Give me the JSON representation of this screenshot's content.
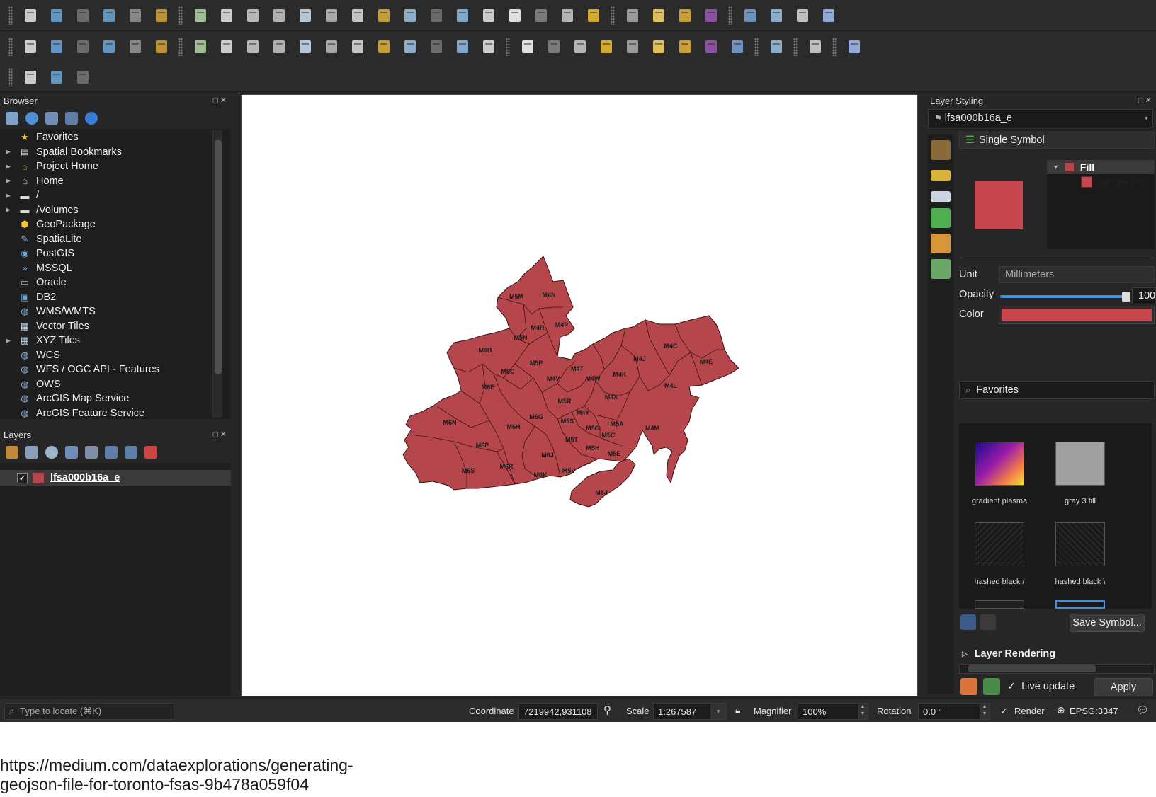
{
  "toolbar": {
    "row1_icons": [
      "new-project-icon",
      "open-project-icon",
      "save-project-icon",
      "new-print-layout-icon",
      "layout-manager-icon",
      "style-manager-icon",
      "pan-map-icon",
      "pan-to-selection-icon",
      "zoom-in-icon",
      "zoom-out-icon",
      "zoom-full-icon",
      "zoom-to-selection-icon",
      "zoom-to-layer-icon",
      "zoom-native-icon",
      "zoom-last-icon",
      "zoom-next-icon",
      "new-map-view-icon",
      "new-3d-view-icon",
      "new-bookmark-icon",
      "show-bookmarks-icon",
      "temporal-controller-icon",
      "refresh-icon",
      "identify-features-icon",
      "attribute-table-icon",
      "field-calculator-icon",
      "statistics-icon",
      "measure-icon",
      "map-tips-icon",
      "settings-gear-icon",
      "text-annotation-icon"
    ],
    "row2_icons": [
      "data-source-manager-icon",
      "new-geopackage-layer-icon",
      "new-temporary-layer-icon",
      "digitize-icon",
      "create-layer-icon",
      "virtual-layer-icon",
      "current-edits-icon",
      "toggle-editing-icon",
      "save-edits-icon",
      "add-feature-icon",
      "vertex-tool-icon",
      "modify-attributes-icon",
      "delete-selected-icon",
      "cut-features-icon",
      "copy-features-icon",
      "paste-features-icon",
      "undo-icon",
      "redo-icon",
      "layer-labeling-icon",
      "layer-diagram-icon",
      "pin-labels-icon",
      "show-hide-labels-icon",
      "label-highlight-icon",
      "move-label-icon",
      "rotate-label-icon",
      "change-label-icon",
      "label-properties-icon",
      "plugins-globe-icon",
      "python-console-icon",
      "help-icon"
    ],
    "row3_icons": [
      "select-features-icon",
      "select-by-value-icon",
      "deselect-features-icon"
    ]
  },
  "browser": {
    "title": "Browser",
    "items": [
      {
        "label": "Favorites",
        "icon": "star-icon",
        "expandable": false
      },
      {
        "label": "Spatial Bookmarks",
        "icon": "bookmark-icon",
        "expandable": true
      },
      {
        "label": "Project Home",
        "icon": "project-home-icon",
        "expandable": true
      },
      {
        "label": "Home",
        "icon": "home-icon",
        "expandable": true
      },
      {
        "label": "/",
        "icon": "folder-icon",
        "expandable": true
      },
      {
        "label": "/Volumes",
        "icon": "folder-icon",
        "expandable": true
      },
      {
        "label": "GeoPackage",
        "icon": "geopackage-icon",
        "expandable": false
      },
      {
        "label": "SpatiaLite",
        "icon": "spatialite-icon",
        "expandable": false
      },
      {
        "label": "PostGIS",
        "icon": "postgis-icon",
        "expandable": false
      },
      {
        "label": "MSSQL",
        "icon": "mssql-icon",
        "expandable": false
      },
      {
        "label": "Oracle",
        "icon": "oracle-icon",
        "expandable": false
      },
      {
        "label": "DB2",
        "icon": "db2-icon",
        "expandable": false
      },
      {
        "label": "WMS/WMTS",
        "icon": "wms-globe-icon",
        "expandable": false
      },
      {
        "label": "Vector Tiles",
        "icon": "vector-tiles-icon",
        "expandable": false
      },
      {
        "label": "XYZ Tiles",
        "icon": "xyz-tiles-icon",
        "expandable": true
      },
      {
        "label": "WCS",
        "icon": "wcs-globe-icon",
        "expandable": false
      },
      {
        "label": "WFS / OGC API - Features",
        "icon": "wfs-globe-icon",
        "expandable": false
      },
      {
        "label": "OWS",
        "icon": "ows-globe-icon",
        "expandable": false
      },
      {
        "label": "ArcGIS Map Service",
        "icon": "arcgis-globe-icon",
        "expandable": false
      },
      {
        "label": "ArcGIS Feature Service",
        "icon": "arcgis-globe-icon",
        "expandable": false
      }
    ]
  },
  "layers": {
    "title": "Layers",
    "items": [
      {
        "name": "lfsa000b16a_e",
        "checked": true,
        "color": "#b5474c"
      }
    ]
  },
  "map": {
    "fill_color": "#b5474c",
    "stroke_color": "#3b1214",
    "labels": [
      "M5M",
      "M4N",
      "M4R",
      "M4P",
      "M5N",
      "M6B",
      "M5P",
      "M6C",
      "M4T",
      "M4V",
      "M4W",
      "M4K",
      "M4J",
      "M4C",
      "M4E",
      "M6E",
      "M4L",
      "M5R",
      "M4X",
      "M6N",
      "M6G",
      "M4Y",
      "M5S",
      "M5A",
      "M6H",
      "M5G",
      "M5C",
      "M4M",
      "M5T",
      "M6P",
      "M5H",
      "M5E",
      "M6J",
      "M6R",
      "M6S",
      "M6K",
      "M5V",
      "M5J"
    ]
  },
  "styling": {
    "title": "Layer Styling",
    "layer_select": "lfsa000b16a_e",
    "renderer": "Single Symbol",
    "tree": {
      "fill": "Fill",
      "simple_fill": "Simple Fill"
    },
    "unit_label": "Unit",
    "unit_value": "Millimeters",
    "opacity_label": "Opacity",
    "opacity_value": "100",
    "opacity_fraction": 1.0,
    "color_label": "Color",
    "symbol_color": "#c8464d",
    "search": "Favorites",
    "library": [
      {
        "label": "gradient  plasma"
      },
      {
        "label": "gray 3 fill"
      },
      {
        "label": "hashed black /"
      },
      {
        "label": "hashed black \\"
      }
    ],
    "save_symbol": "Save Symbol...",
    "layer_rendering": "Layer Rendering",
    "live_update": "Live update",
    "apply": "Apply"
  },
  "statusbar": {
    "locate_placeholder": "Type to locate (⌘K)",
    "coordinate_label": "Coordinate",
    "coordinate_value": "7219942,931108",
    "scale_label": "Scale",
    "scale_value": "1:267587",
    "magnifier_label": "Magnifier",
    "magnifier_value": "100%",
    "rotation_label": "Rotation",
    "rotation_value": "0.0 °",
    "render_label": "Render",
    "crs": "EPSG:3347"
  },
  "caption": {
    "line1": "https://medium.com/dataexplorations/generating-",
    "line2": "geojson-file-for-toronto-fsas-9b478a059f04"
  }
}
